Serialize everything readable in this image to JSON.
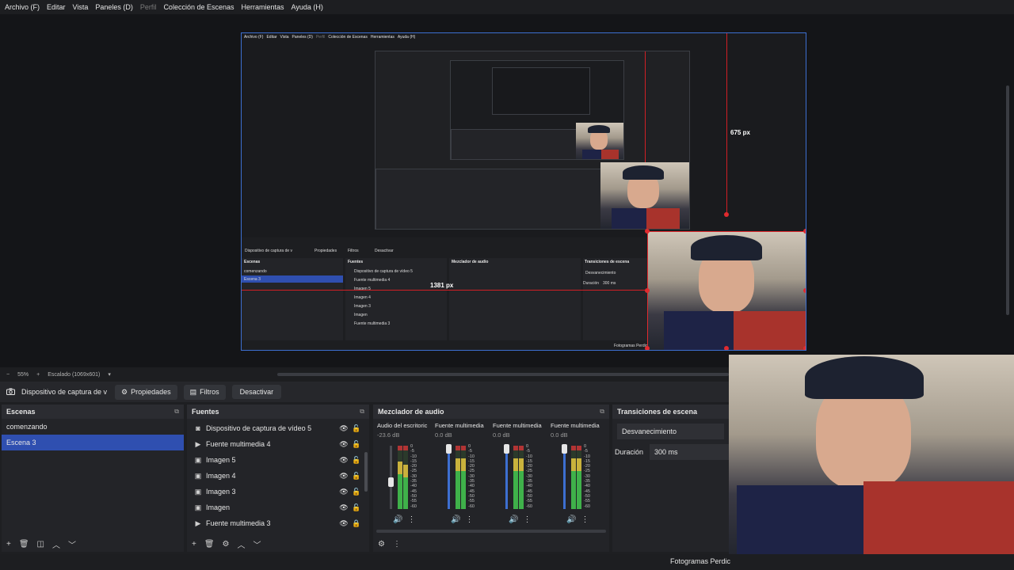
{
  "menu": [
    "Archivo (F)",
    "Editar",
    "Vista",
    "Paneles (D)",
    "Perfil",
    "Colección de Escenas",
    "Herramientas",
    "Ayuda (H)"
  ],
  "preview": {
    "measure_vertical": "675 px",
    "measure_horizontal": "1381 px",
    "frames_label": "Fotogramas Perdic"
  },
  "status_top": {
    "zoom": "55%",
    "scale_mode": "Escalado (1069x601)"
  },
  "toolbar": {
    "source_name": "Dispositivo de captura de v",
    "properties": "Propiedades",
    "filters": "Filtros",
    "deactivate": "Desactivar"
  },
  "scenes": {
    "title": "Escenas",
    "items": [
      "comenzando",
      "Escena 3"
    ],
    "active_index": 1
  },
  "sources": {
    "title": "Fuentes",
    "items": [
      {
        "label": "Dispositivo de captura de vídeo 5",
        "icon": "camera-icon"
      },
      {
        "label": "Fuente multimedia 4",
        "icon": "play-icon"
      },
      {
        "label": "Imagen 5",
        "icon": "image-icon"
      },
      {
        "label": "Imagen 4",
        "icon": "image-icon"
      },
      {
        "label": "Imagen 3",
        "icon": "image-icon"
      },
      {
        "label": "Imagen",
        "icon": "image-icon"
      },
      {
        "label": "Fuente multimedia 3",
        "icon": "play-icon"
      }
    ]
  },
  "mixer": {
    "title": "Mezclador de audio",
    "channels": [
      {
        "name": "Audio del escritoric",
        "db": "-23.6 dB"
      },
      {
        "name": "Fuente multimedia",
        "db": "0.0 dB"
      },
      {
        "name": "Fuente multimedia",
        "db": "0.0 dB"
      },
      {
        "name": "Fuente multimedia",
        "db": "0.0 dB"
      }
    ],
    "scale": [
      "0",
      "-5",
      "-10",
      "-15",
      "-20",
      "-25",
      "-30",
      "-35",
      "-40",
      "-45",
      "-50",
      "-55",
      "-60"
    ]
  },
  "transitions": {
    "title": "Transiciones de escena",
    "type": "Desvanecimiento",
    "duration_label": "Duración",
    "duration_value": "300 ms"
  },
  "bottom_status": {
    "frames": "Fotogramas Perdic"
  }
}
